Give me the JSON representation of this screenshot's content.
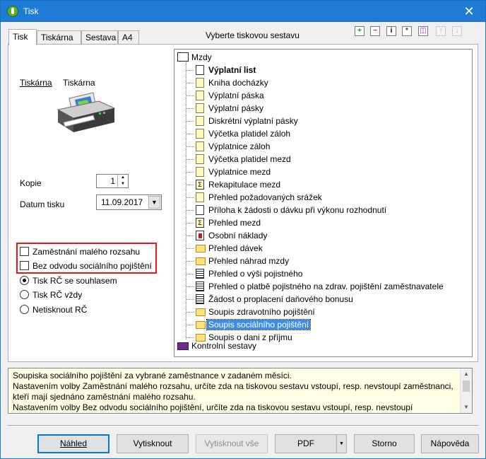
{
  "window": {
    "title": "Tisk"
  },
  "tabs": [
    "Tisk",
    "Tiskárna",
    "Sestava",
    "A4"
  ],
  "sestava_caption": "Vyberte tiskovou sestavu",
  "printer": {
    "link_label": "Tiskárna",
    "name": "Tiskárna"
  },
  "kopie": {
    "label": "Kopie",
    "value": "1"
  },
  "datum": {
    "label": "Datum tisku",
    "value": "11.09.2017"
  },
  "options": {
    "checkboxes": [
      {
        "label": "Zaměstnání malého rozsahu",
        "checked": false
      },
      {
        "label": "Bez odvodu sociálního pojištění",
        "checked": false
      }
    ],
    "radios": [
      {
        "label": "Tisk RČ se souhlasem",
        "checked": true
      },
      {
        "label": "Tisk RČ vždy",
        "checked": false
      },
      {
        "label": "Netisknout RČ",
        "checked": false
      }
    ]
  },
  "tree": {
    "root": "Mzdy",
    "items": [
      {
        "label": "Výplatní list",
        "icon": "white-doc-icon",
        "bold": true
      },
      {
        "label": "Kniha docházky",
        "icon": "yellow-doc-icon"
      },
      {
        "label": "Výplatní páska",
        "icon": "yellow-doc-icon"
      },
      {
        "label": "Výplatní pásky",
        "icon": "yellow-doc-icon"
      },
      {
        "label": "Diskrétní výplatní pásky",
        "icon": "yellow-doc-icon"
      },
      {
        "label": "Výčetka platidel záloh",
        "icon": "yellow-doc-icon"
      },
      {
        "label": "Výplatnice záloh",
        "icon": "yellow-doc-icon"
      },
      {
        "label": "Výčetka platidel mezd",
        "icon": "yellow-doc-icon"
      },
      {
        "label": "Výplatnice mezd",
        "icon": "yellow-doc-icon"
      },
      {
        "label": "Rekapitulace mezd",
        "icon": "sigma-doc-icon"
      },
      {
        "label": "Přehled požadovaných srážek",
        "icon": "yellow-doc-icon"
      },
      {
        "label": "Příloha k žádosti o dávku při výkonu rozhodnutí",
        "icon": "white-doc-icon"
      },
      {
        "label": "Přehled mezd",
        "icon": "sigma-doc-icon"
      },
      {
        "label": "Osobní náklady",
        "icon": "red-doc-icon"
      },
      {
        "label": "Přehled dávek",
        "icon": "folder-icon"
      },
      {
        "label": "Přehled náhrad mzdy",
        "icon": "folder-icon"
      },
      {
        "label": "Přehled o výši pojistného",
        "icon": "lines-doc-icon"
      },
      {
        "label": "Přehled o platbě pojistného na zdrav. pojištění zaměstnavatele",
        "icon": "lines-doc-icon"
      },
      {
        "label": "Žádost o proplacení daňového bonusu",
        "icon": "lines-doc-icon"
      },
      {
        "label": "Soupis zdravotního pojištění",
        "icon": "folder-icon"
      },
      {
        "label": "Soupis sociálního pojištění",
        "icon": "folder-icon",
        "selected": true
      },
      {
        "label": "Soupis o dani z příjmu",
        "icon": "folder-icon"
      }
    ],
    "footer": "Kontrolní sestavy"
  },
  "description": [
    "Soupiska sociálního pojištění za vybrané zaměstnance v zadaném měsíci.",
    "Nastavením volby Zaměstnání malého rozsahu, určíte zda na tiskovou sestavu vstoupí, resp. nevstoupí zaměstnanci,",
    "kteří mají sjednáno zaměstnání malého rozsahu.",
    "Nastavením volby Bez odvodu sociálního pojištění, určíte zda na tiskovou sestavu vstoupí, resp. nevstoupí"
  ],
  "buttons": {
    "nahled": "Náhled",
    "vytisknout": "Vytisknout",
    "vytisknout_vse": "Vytisknout vše",
    "pdf": "PDF",
    "storno": "Storno",
    "napoveda": "Nápověda"
  },
  "colors": {
    "titlebar": "#1e7bd6",
    "selection": "#3a8ee6",
    "highlight_border": "#e0191e",
    "description_bg": "#ffffe5"
  }
}
